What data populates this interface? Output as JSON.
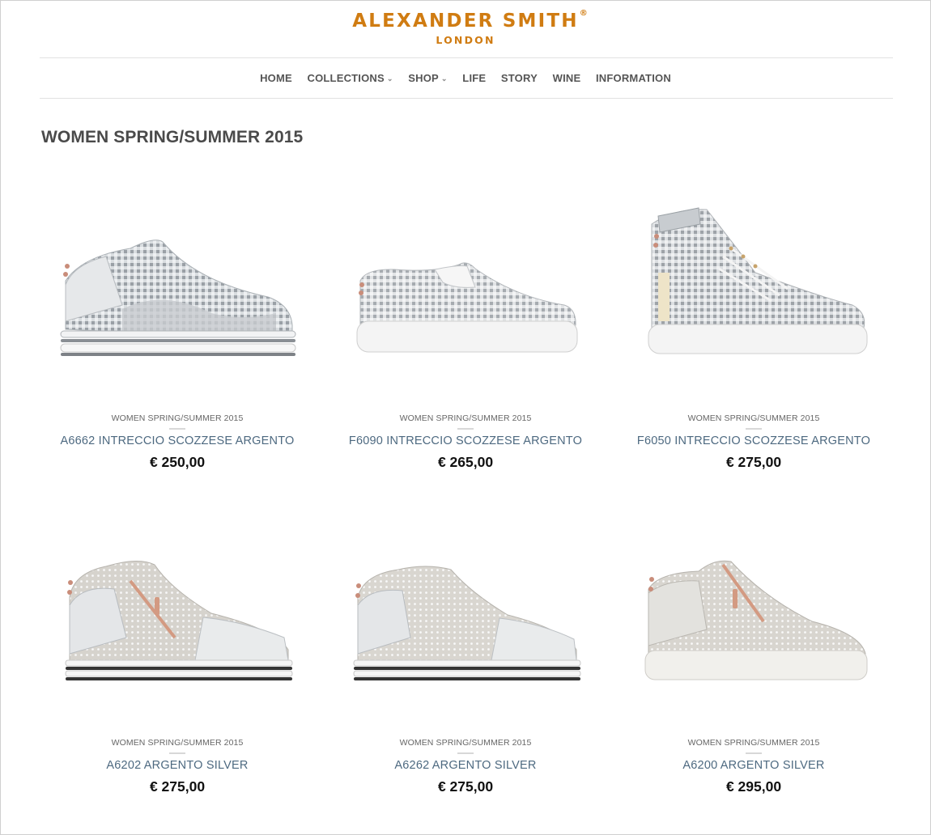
{
  "header": {
    "logo_text": "ALEXANDER SMITH",
    "logo_registered": "®",
    "logo_sub": "LONDON"
  },
  "nav": {
    "items": [
      {
        "label": "HOME"
      },
      {
        "label": "COLLECTIONS"
      },
      {
        "label": "SHOP"
      },
      {
        "label": "LIFE"
      },
      {
        "label": "STORY"
      },
      {
        "label": "WINE"
      },
      {
        "label": "INFORMATION"
      }
    ],
    "dropdown_icon": "chevron-down-icon"
  },
  "page": {
    "title": "WOMEN SPRING/SUMMER 2015"
  },
  "products": [
    {
      "category": "WOMEN SPRING/SUMMER 2015",
      "name": "A6662 INTRECCIO SCOZZESE ARGENTO",
      "price": "€ 250,00"
    },
    {
      "category": "WOMEN SPRING/SUMMER 2015",
      "name": "F6090 INTRECCIO SCOZZESE ARGENTO",
      "price": "€ 265,00"
    },
    {
      "category": "WOMEN SPRING/SUMMER 2015",
      "name": "F6050 INTRECCIO SCOZZESE ARGENTO",
      "price": "€ 275,00"
    },
    {
      "category": "WOMEN SPRING/SUMMER 2015",
      "name": "A6202 ARGENTO SILVER",
      "price": "€ 275,00"
    },
    {
      "category": "WOMEN SPRING/SUMMER 2015",
      "name": "A6262 ARGENTO SILVER",
      "price": "€ 275,00"
    },
    {
      "category": "WOMEN SPRING/SUMMER 2015",
      "name": "A6200 ARGENTO SILVER",
      "price": "€ 295,00"
    }
  ],
  "colors": {
    "brand": "#d07c12",
    "product_name": "#4d6980",
    "price": "#111111"
  }
}
